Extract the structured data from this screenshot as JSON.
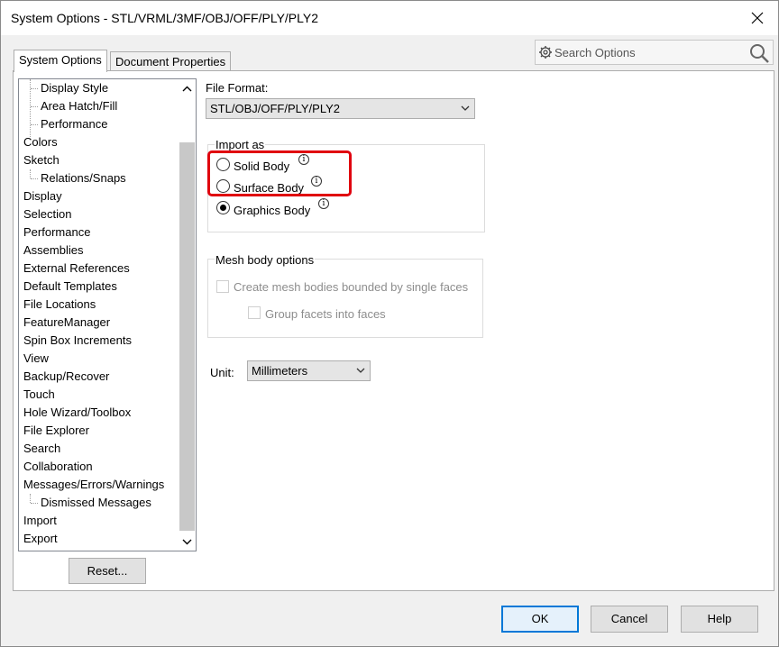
{
  "window": {
    "title": "System Options - STL/VRML/3MF/OBJ/OFF/PLY/PLY2"
  },
  "search": {
    "placeholder": "Search Options"
  },
  "tabs": [
    {
      "label": "System Options",
      "active": true
    },
    {
      "label": "Document Properties",
      "active": false
    }
  ],
  "tree": {
    "items": [
      {
        "label": "Display Style",
        "level": 1
      },
      {
        "label": "Area Hatch/Fill",
        "level": 1
      },
      {
        "label": "Performance",
        "level": 1
      },
      {
        "label": "Colors",
        "level": 0
      },
      {
        "label": "Sketch",
        "level": 0
      },
      {
        "label": "Relations/Snaps",
        "level": 1
      },
      {
        "label": "Display",
        "level": 0
      },
      {
        "label": "Selection",
        "level": 0
      },
      {
        "label": "Performance",
        "level": 0
      },
      {
        "label": "Assemblies",
        "level": 0
      },
      {
        "label": "External References",
        "level": 0
      },
      {
        "label": "Default Templates",
        "level": 0
      },
      {
        "label": "File Locations",
        "level": 0
      },
      {
        "label": "FeatureManager",
        "level": 0
      },
      {
        "label": "Spin Box Increments",
        "level": 0
      },
      {
        "label": "View",
        "level": 0
      },
      {
        "label": "Backup/Recover",
        "level": 0
      },
      {
        "label": "Touch",
        "level": 0
      },
      {
        "label": "Hole Wizard/Toolbox",
        "level": 0
      },
      {
        "label": "File Explorer",
        "level": 0
      },
      {
        "label": "Search",
        "level": 0
      },
      {
        "label": "Collaboration",
        "level": 0
      },
      {
        "label": "Messages/Errors/Warnings",
        "level": 0
      },
      {
        "label": "Dismissed Messages",
        "level": 1
      },
      {
        "label": "Import",
        "level": 0,
        "selected": true
      },
      {
        "label": "Export",
        "level": 0
      }
    ]
  },
  "reset_label": "Reset...",
  "file_format": {
    "label": "File Format:",
    "value": "STL/OBJ/OFF/PLY/PLY2"
  },
  "import_as": {
    "title": "Import as",
    "options": [
      {
        "label": "Solid Body",
        "checked": false
      },
      {
        "label": "Surface Body",
        "checked": false
      },
      {
        "label": "Graphics Body",
        "checked": true
      }
    ]
  },
  "mesh_options": {
    "title": "Mesh body options",
    "create_mesh": "Create mesh bodies bounded by single faces",
    "group_facets": "Group facets into faces"
  },
  "unit": {
    "label": "Unit:",
    "value": "Millimeters"
  },
  "buttons": {
    "ok": "OK",
    "cancel": "Cancel",
    "help": "Help"
  },
  "colors": {
    "highlight": "#e0000e",
    "primary_border": "#0078d7"
  },
  "icons": {
    "close": "close-icon",
    "gear": "gear-icon",
    "search": "search-icon",
    "info": "info-icon"
  }
}
